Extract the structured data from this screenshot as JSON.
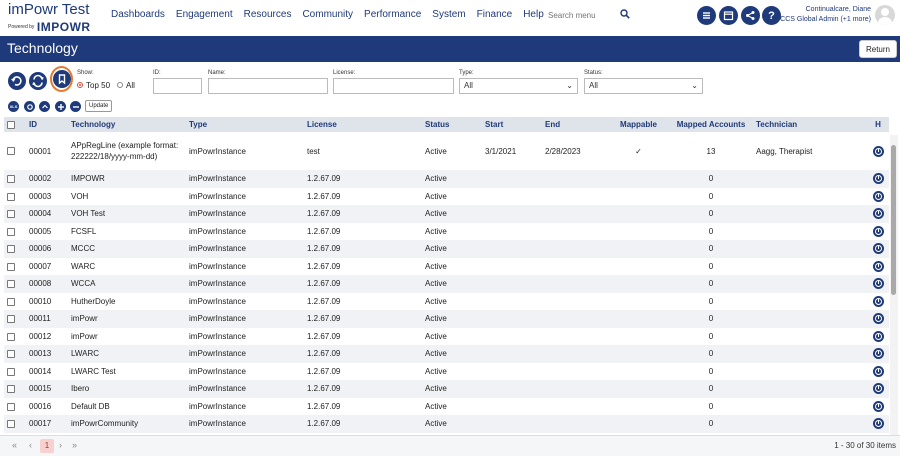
{
  "brand": {
    "title": "imPowr Test",
    "powered_by": "Powered by",
    "logo": "IMPOWR"
  },
  "nav": [
    "Dashboards",
    "Engagement",
    "Resources",
    "Community",
    "Performance",
    "System",
    "Finance",
    "Help"
  ],
  "search": {
    "placeholder": "Search menu",
    "icon": "search-icon"
  },
  "toolbar_icons": [
    "list-icon",
    "calendar-icon",
    "share-icon",
    "help-icon"
  ],
  "user": {
    "name": "Continualcare, Diane",
    "role": "CCS Global Admin (+1 more)"
  },
  "page": {
    "title": "Technology",
    "return_label": "Return"
  },
  "filters": {
    "show_label": "Show:",
    "top50_label": "Top 50",
    "all_label": "All",
    "id_label": "ID:",
    "name_label": "Name:",
    "license_label": "License:",
    "type_label": "Type:",
    "type_value": "All",
    "status_label": "Status:",
    "status_value": "All"
  },
  "small_actions": {
    "xls_label": "XLS",
    "update_label": "Update"
  },
  "table": {
    "columns": [
      "ID",
      "Technology",
      "Type",
      "License",
      "Status",
      "Start",
      "End",
      "Mappable",
      "Mapped Accounts",
      "Technician",
      "H"
    ],
    "rows": [
      {
        "id": "00001",
        "technology": "APpRegLine (example format: 222222/18/yyyy-mm-dd)",
        "type": "imPowrInstance",
        "license": "test",
        "status": "Active",
        "start": "3/1/2021",
        "end": "2/28/2023",
        "mappable": "✓",
        "mapped": "13",
        "technician": "Aagg, Therapist"
      },
      {
        "id": "00002",
        "technology": "IMPOWR",
        "type": "imPowrInstance",
        "license": "1.2.67.09",
        "status": "Active",
        "start": "",
        "end": "",
        "mappable": "",
        "mapped": "0",
        "technician": ""
      },
      {
        "id": "00003",
        "technology": "VOH",
        "type": "imPowrInstance",
        "license": "1.2.67.09",
        "status": "Active",
        "start": "",
        "end": "",
        "mappable": "",
        "mapped": "0",
        "technician": ""
      },
      {
        "id": "00004",
        "technology": "VOH Test",
        "type": "imPowrInstance",
        "license": "1.2.67.09",
        "status": "Active",
        "start": "",
        "end": "",
        "mappable": "",
        "mapped": "0",
        "technician": ""
      },
      {
        "id": "00005",
        "technology": "FCSFL",
        "type": "imPowrInstance",
        "license": "1.2.67.09",
        "status": "Active",
        "start": "",
        "end": "",
        "mappable": "",
        "mapped": "0",
        "technician": ""
      },
      {
        "id": "00006",
        "technology": "MCCC",
        "type": "imPowrInstance",
        "license": "1.2.67.09",
        "status": "Active",
        "start": "",
        "end": "",
        "mappable": "",
        "mapped": "0",
        "technician": ""
      },
      {
        "id": "00007",
        "technology": "WARC",
        "type": "imPowrInstance",
        "license": "1.2.67.09",
        "status": "Active",
        "start": "",
        "end": "",
        "mappable": "",
        "mapped": "0",
        "technician": ""
      },
      {
        "id": "00008",
        "technology": "WCCA",
        "type": "imPowrInstance",
        "license": "1.2.67.09",
        "status": "Active",
        "start": "",
        "end": "",
        "mappable": "",
        "mapped": "0",
        "technician": ""
      },
      {
        "id": "00010",
        "technology": "HutherDoyle",
        "type": "imPowrInstance",
        "license": "1.2.67.09",
        "status": "Active",
        "start": "",
        "end": "",
        "mappable": "",
        "mapped": "0",
        "technician": ""
      },
      {
        "id": "00011",
        "technology": "imPowr",
        "type": "imPowrInstance",
        "license": "1.2.67.09",
        "status": "Active",
        "start": "",
        "end": "",
        "mappable": "",
        "mapped": "0",
        "technician": ""
      },
      {
        "id": "00012",
        "technology": "imPowr",
        "type": "imPowrInstance",
        "license": "1.2.67.09",
        "status": "Active",
        "start": "",
        "end": "",
        "mappable": "",
        "mapped": "0",
        "technician": ""
      },
      {
        "id": "00013",
        "technology": "LWARC",
        "type": "imPowrInstance",
        "license": "1.2.67.09",
        "status": "Active",
        "start": "",
        "end": "",
        "mappable": "",
        "mapped": "0",
        "technician": ""
      },
      {
        "id": "00014",
        "technology": "LWARC Test",
        "type": "imPowrInstance",
        "license": "1.2.67.09",
        "status": "Active",
        "start": "",
        "end": "",
        "mappable": "",
        "mapped": "0",
        "technician": ""
      },
      {
        "id": "00015",
        "technology": "Ibero",
        "type": "imPowrInstance",
        "license": "1.2.67.09",
        "status": "Active",
        "start": "",
        "end": "",
        "mappable": "",
        "mapped": "0",
        "technician": ""
      },
      {
        "id": "00016",
        "technology": "Default DB",
        "type": "imPowrInstance",
        "license": "1.2.67.09",
        "status": "Active",
        "start": "",
        "end": "",
        "mappable": "",
        "mapped": "0",
        "technician": ""
      },
      {
        "id": "00017",
        "technology": "imPowrCommunity",
        "type": "imPowrInstance",
        "license": "1.2.67.09",
        "status": "Active",
        "start": "",
        "end": "",
        "mappable": "",
        "mapped": "0",
        "technician": ""
      }
    ]
  },
  "pager": {
    "first": "«",
    "prev": "‹",
    "current": "1",
    "next": "›",
    "last": "»",
    "summary": "1 - 30 of 30 items"
  },
  "colors": {
    "navy": "#1f3a7a",
    "highlight": "#e57a2f",
    "header_bg": "#dfe3ea"
  }
}
